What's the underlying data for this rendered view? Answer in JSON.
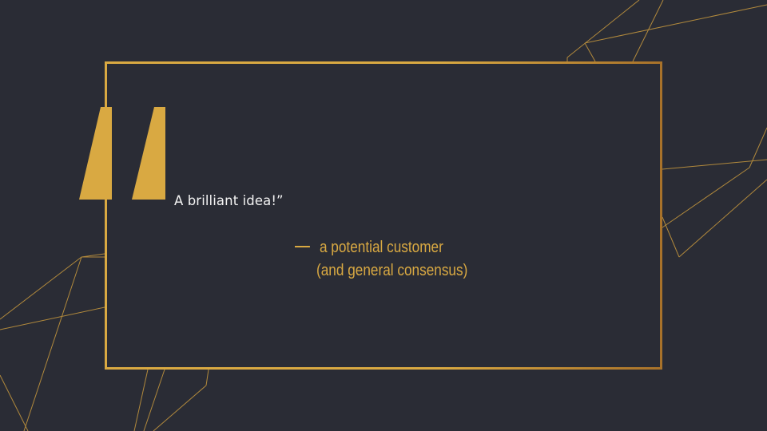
{
  "slide": {
    "quote": "A brilliant idea!”",
    "attribution_line1": "a potential customer",
    "attribution_line2": "(and general consensus)"
  },
  "colors": {
    "background": "#2a2c35",
    "accent_gold": "#d9a942",
    "frame_gold_dark": "#a8722a",
    "quote_text": "#f2f2f2"
  },
  "icons": {
    "quote_mark": "opening-quote-icon",
    "dash": "em-dash-icon"
  }
}
